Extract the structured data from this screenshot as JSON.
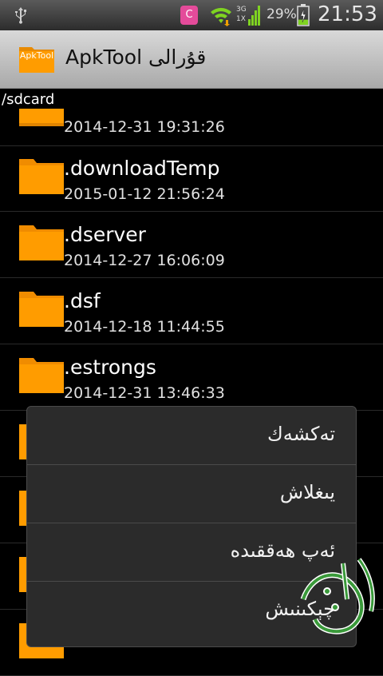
{
  "status_bar": {
    "usb_icon": "usb-icon",
    "app_icon": "notification-app-icon",
    "app_letter": "C",
    "wifi_icon": "wifi-icon",
    "network_label_top": "3G",
    "network_label_bottom": "1X",
    "battery_percent": "29%",
    "battery_level": 0.29,
    "time": "21:53"
  },
  "title_bar": {
    "logo_text": "ApkTool",
    "title": "ApkTool قۇرالى"
  },
  "path": "/sdcard",
  "files": [
    {
      "name": "",
      "date": "2014-12-31 19:31:26"
    },
    {
      "name": ".downloadTemp",
      "date": "2015-01-12 21:56:24"
    },
    {
      "name": ".dserver",
      "date": "2014-12-27 16:06:09"
    },
    {
      "name": ".dsf",
      "date": "2014-12-18 11:44:55"
    },
    {
      "name": ".estrongs",
      "date": "2014-12-31 13:46:33"
    }
  ],
  "context_menu": {
    "items": [
      {
        "label": "تەكشەك"
      },
      {
        "label": "يىغلاش"
      },
      {
        "label": "ئەپ ھەققىدە"
      },
      {
        "label": "چېكىنىش"
      }
    ]
  },
  "colors": {
    "folder": "#ff9c00",
    "menu_bg": "#2b2b2b",
    "titlebar": "#bdbdbd"
  }
}
